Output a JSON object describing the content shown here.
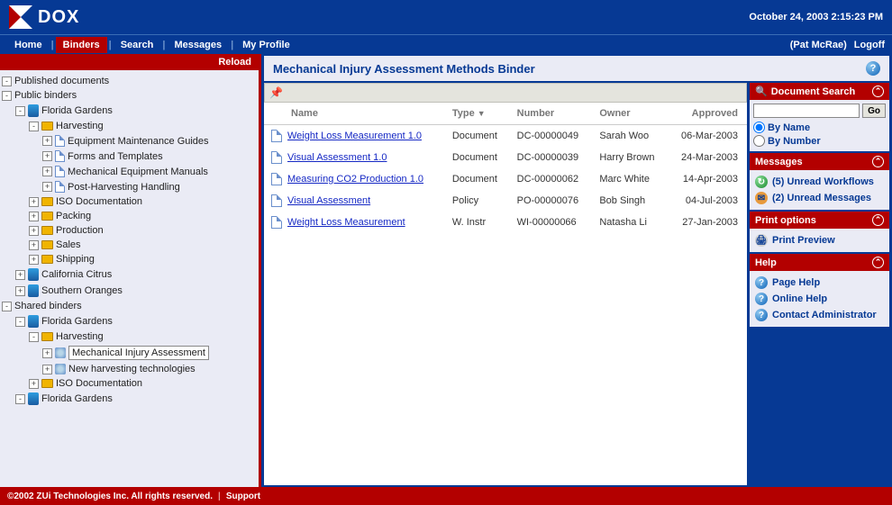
{
  "header": {
    "app_name": "DOX",
    "datetime": "October 24, 2003 2:15:23 PM"
  },
  "nav": {
    "items": [
      "Home",
      "Binders",
      "Search",
      "Messages",
      "My Profile"
    ],
    "active_index": 1,
    "user_label": "(Pat McRae)",
    "logoff": "Logoff"
  },
  "sidebar": {
    "reload": "Reload",
    "tree": [
      {
        "lvl": 0,
        "box": "-",
        "ic": "",
        "label": "Published documents"
      },
      {
        "lvl": 0,
        "box": "-",
        "ic": "",
        "label": "Public binders"
      },
      {
        "lvl": 1,
        "box": "-",
        "ic": "building",
        "label": "Florida Gardens"
      },
      {
        "lvl": 2,
        "box": "-",
        "ic": "folder",
        "label": "Harvesting"
      },
      {
        "lvl": 3,
        "box": "+",
        "ic": "doc",
        "label": "Equipment Maintenance Guides"
      },
      {
        "lvl": 3,
        "box": "+",
        "ic": "doc",
        "label": "Forms and Templates"
      },
      {
        "lvl": 3,
        "box": "+",
        "ic": "doc",
        "label": "Mechanical Equipment Manuals"
      },
      {
        "lvl": 3,
        "box": "+",
        "ic": "doc",
        "label": "Post-Harvesting Handling"
      },
      {
        "lvl": 2,
        "box": "+",
        "ic": "folder",
        "label": "ISO Documentation"
      },
      {
        "lvl": 2,
        "box": "+",
        "ic": "folder",
        "label": "Packing"
      },
      {
        "lvl": 2,
        "box": "+",
        "ic": "folder",
        "label": "Production"
      },
      {
        "lvl": 2,
        "box": "+",
        "ic": "folder",
        "label": "Sales"
      },
      {
        "lvl": 2,
        "box": "+",
        "ic": "folder",
        "label": "Shipping"
      },
      {
        "lvl": 1,
        "box": "+",
        "ic": "building",
        "label": "California Citrus"
      },
      {
        "lvl": 1,
        "box": "+",
        "ic": "building",
        "label": "Southern Oranges"
      },
      {
        "lvl": 0,
        "box": "-",
        "ic": "",
        "label": "Shared binders"
      },
      {
        "lvl": 1,
        "box": "-",
        "ic": "building",
        "label": "Florida Gardens"
      },
      {
        "lvl": 2,
        "box": "-",
        "ic": "folder",
        "label": "Harvesting"
      },
      {
        "lvl": 3,
        "box": "+",
        "ic": "pin",
        "label": "Mechanical Injury Assessment",
        "sel": true
      },
      {
        "lvl": 3,
        "box": "+",
        "ic": "pin",
        "label": "New harvesting technologies"
      },
      {
        "lvl": 2,
        "box": "+",
        "ic": "folder",
        "label": "ISO Documentation"
      },
      {
        "lvl": 1,
        "box": "-",
        "ic": "building",
        "label": "Florida Gardens"
      }
    ]
  },
  "main": {
    "title": "Mechanical Injury Assessment Methods Binder",
    "columns": {
      "name": "Name",
      "type": "Type",
      "number": "Number",
      "owner": "Owner",
      "approved": "Approved",
      "sort_indicator": "▼"
    },
    "rows": [
      {
        "name": "Weight Loss Measurement 1.0",
        "link": true,
        "type": "Document",
        "number": "DC-00000049",
        "owner": "Sarah Woo",
        "approved": "06-Mar-2003"
      },
      {
        "name": "Visual Assessment 1.0",
        "link": true,
        "type": "Document",
        "number": "DC-00000039",
        "owner": "Harry Brown",
        "approved": "24-Mar-2003"
      },
      {
        "name": "Measuring CO2 Production 1.0",
        "link": true,
        "type": "Document",
        "number": "DC-00000062",
        "owner": "Marc White",
        "approved": "14-Apr-2003"
      },
      {
        "name": "Visual Assessment",
        "link": true,
        "type": "Policy",
        "number": "PO-00000076",
        "owner": "Bob Singh",
        "approved": "04-Jul-2003"
      },
      {
        "name": "Weight Loss Measurement",
        "link": true,
        "type": "W. Instr",
        "number": "WI-00000066",
        "owner": "Natasha Li",
        "approved": "27-Jan-2003"
      }
    ]
  },
  "panels": {
    "search": {
      "title": "Document Search",
      "go": "Go",
      "by_name": "By Name",
      "by_number": "By Number",
      "placeholder": ""
    },
    "messages": {
      "title": "Messages",
      "workflows": "(5) Unread Workflows",
      "unread": "(2) Unread Messages"
    },
    "print": {
      "title": "Print options",
      "preview": "Print Preview"
    },
    "help": {
      "title": "Help",
      "page": "Page Help",
      "online": "Online Help",
      "contact": "Contact Administrator"
    }
  },
  "footer": {
    "copyright": "©2002 ZUi Technologies Inc. All rights reserved.",
    "support": "Support"
  }
}
